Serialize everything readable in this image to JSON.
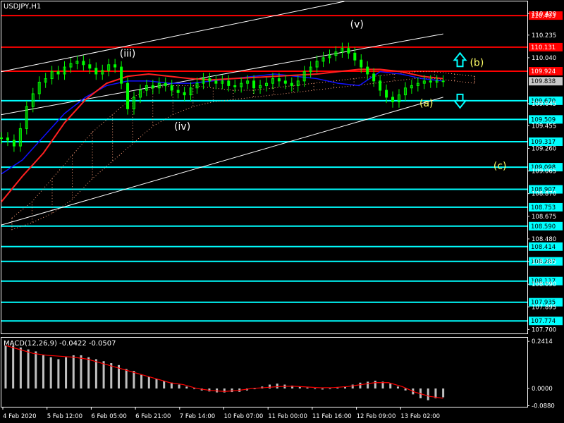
{
  "chart_data": {
    "type": "line",
    "symbol": "USDJPY,H1",
    "indicator_label": "MACD(12,26,9) -0.0422 -0.0507",
    "colors": {
      "background": "#000000",
      "price": "#00ff00",
      "resistance": "#ff0000",
      "support": "#00ffff",
      "channel": "#ffffff",
      "ma_fast": "#1010ff",
      "ma_slow": "#ff2020",
      "cloud": "#ffa07a",
      "macd_hist": "#c0c0c0",
      "macd_signal": "#ff0000",
      "arrow": "#00ffff",
      "wave_white": "#ffffff",
      "wave_yellow": "#ffff66"
    },
    "price_axis": {
      "ylim": [
        107.66,
        110.525
      ],
      "ticks": [
        "110.420",
        "110.235",
        "110.040",
        "109.645",
        "109.455",
        "109.260",
        "109.065",
        "108.870",
        "108.675",
        "108.480",
        "108.285",
        "108.090",
        "107.895",
        "107.700"
      ]
    },
    "resistance_levels": [
      "110.403",
      "110.131",
      "109.924"
    ],
    "support_levels": [
      "109.670",
      "109.509",
      "109.317",
      "109.098",
      "108.907",
      "108.753",
      "108.590",
      "108.414",
      "108.287",
      "108.117",
      "107.935",
      "107.774"
    ],
    "current_price": "109.838",
    "x_axis": {
      "labels": [
        "4 Feb 2020",
        "5 Feb 12:00",
        "6 Feb 05:00",
        "6 Feb 21:00",
        "7 Feb 14:00",
        "10 Feb 07:00",
        "11 Feb 00:00",
        "11 Feb 16:00",
        "12 Feb 09:00",
        "13 Feb 02:00"
      ]
    },
    "price_series": {
      "t": [
        0,
        3,
        6,
        9,
        12,
        15,
        18,
        21,
        24,
        27,
        30,
        33,
        36,
        39,
        42,
        45,
        48,
        51,
        54,
        57,
        60,
        63,
        66,
        69,
        72,
        75,
        78,
        81,
        84,
        87,
        90,
        93,
        96,
        99,
        102,
        105,
        108,
        111,
        114,
        117,
        120,
        123,
        126,
        129,
        132,
        135,
        138,
        141,
        144,
        147,
        150,
        153,
        156,
        159,
        162,
        165,
        168,
        171,
        174,
        177,
        180,
        183,
        186,
        189,
        192,
        195,
        198,
        201,
        204,
        207,
        210
      ],
      "close": [
        109.35,
        109.33,
        109.28,
        109.43,
        109.62,
        109.73,
        109.83,
        109.86,
        109.92,
        109.9,
        109.96,
        109.99,
        110.01,
        109.98,
        109.95,
        109.9,
        109.93,
        109.98,
        109.96,
        109.82,
        109.6,
        109.7,
        109.76,
        109.8,
        109.78,
        109.82,
        109.8,
        109.76,
        109.74,
        109.72,
        109.78,
        109.82,
        109.86,
        109.84,
        109.82,
        109.84,
        109.8,
        109.79,
        109.82,
        109.84,
        109.78,
        109.8,
        109.82,
        109.86,
        109.84,
        109.82,
        109.8,
        109.84,
        109.92,
        109.96,
        110.01,
        110.04,
        110.06,
        110.09,
        110.12,
        110.08,
        110.02,
        109.96,
        109.9,
        109.84,
        109.76,
        109.7,
        109.66,
        109.72,
        109.78,
        109.8,
        109.82,
        109.84,
        109.83,
        109.84,
        109.84
      ]
    },
    "ma_fast": [
      109.04,
      109.16,
      109.36,
      109.56,
      109.7,
      109.8,
      109.84,
      109.84,
      109.82,
      109.82,
      109.84,
      109.86,
      109.88,
      109.9,
      109.88,
      109.86,
      109.82,
      109.8,
      109.92,
      109.9,
      109.86,
      109.84
    ],
    "ma_slow": [
      108.8,
      109.02,
      109.22,
      109.48,
      109.68,
      109.82,
      109.88,
      109.9,
      109.88,
      109.86,
      109.85,
      109.86,
      109.87,
      109.88,
      109.89,
      109.9,
      109.92,
      109.94,
      109.94,
      109.92,
      109.88,
      109.86
    ],
    "cloud": {
      "upper": [
        108.66,
        108.8,
        109.0,
        109.2,
        109.4,
        109.55,
        109.7,
        109.78,
        109.8,
        109.8,
        109.78,
        109.76,
        109.76,
        109.78,
        109.8,
        109.82,
        109.84,
        109.86,
        109.88,
        109.9,
        109.92,
        109.92,
        109.9,
        109.88
      ],
      "lower": [
        108.56,
        108.62,
        108.7,
        108.82,
        109.0,
        109.15,
        109.3,
        109.45,
        109.55,
        109.62,
        109.66,
        109.68,
        109.7,
        109.72,
        109.74,
        109.76,
        109.78,
        109.8,
        109.82,
        109.84,
        109.86,
        109.86,
        109.84,
        109.82
      ]
    },
    "channel_lines": [
      {
        "from": [
          0,
          109.92
        ],
        "to": [
          163,
          110.525
        ]
      },
      {
        "from": [
          0,
          109.55
        ],
        "to": [
          210,
          110.245
        ]
      },
      {
        "from": [
          0,
          108.6
        ],
        "to": [
          210,
          109.7
        ]
      }
    ],
    "wave_labels": [
      {
        "text": "(iii)",
        "t": 60,
        "y": 110.05,
        "color": "white"
      },
      {
        "text": "(iv)",
        "t": 86,
        "y": 109.42,
        "color": "white"
      },
      {
        "text": "(v)",
        "t": 169,
        "y": 110.3,
        "color": "white"
      },
      {
        "text": "(a)",
        "t": 202,
        "y": 109.62,
        "color": "yellow"
      },
      {
        "text": "(b)",
        "t": 226,
        "y": 109.97,
        "color": "yellow"
      },
      {
        "text": "(c)",
        "t": 237,
        "y": 109.08,
        "color": "yellow"
      }
    ],
    "arrows": [
      {
        "dir": "up",
        "t": 218,
        "y": 110.02
      },
      {
        "dir": "down",
        "t": 218,
        "y": 109.67
      }
    ],
    "macd": {
      "ylim": [
        -0.0935,
        0.26
      ],
      "ticks": [
        "0.2414",
        "0.0000",
        "-0.0880"
      ],
      "histogram": [
        0.22,
        0.22,
        0.21,
        0.2,
        0.19,
        0.17,
        0.16,
        0.15,
        0.16,
        0.17,
        0.17,
        0.16,
        0.15,
        0.14,
        0.13,
        0.12,
        0.1,
        0.09,
        0.07,
        0.06,
        0.05,
        0.04,
        0.03,
        0.02,
        0.01,
        0,
        -0.01,
        -0.015,
        -0.02,
        -0.02,
        -0.018,
        -0.017,
        -0.01,
        0,
        0.01,
        0.02,
        0.025,
        0.02,
        0.015,
        0.01,
        0.005,
        0,
        -0.005,
        0,
        0.005,
        0.01,
        0.02,
        0.03,
        0.035,
        0.04,
        0.035,
        0.025,
        0.01,
        -0.01,
        -0.03,
        -0.05,
        -0.06,
        -0.05,
        -0.045
      ],
      "signal": [
        0.22,
        0.2,
        0.18,
        0.17,
        0.165,
        0.16,
        0.15,
        0.13,
        0.11,
        0.09,
        0.07,
        0.05,
        0.03,
        0.02,
        0,
        -0.01,
        -0.015,
        -0.01,
        0,
        0.005,
        0.01,
        0.012,
        0.008,
        0.004,
        0.005,
        0.01,
        0.02,
        0.03,
        0.03,
        0.01,
        -0.02,
        -0.04,
        -0.05
      ]
    }
  }
}
